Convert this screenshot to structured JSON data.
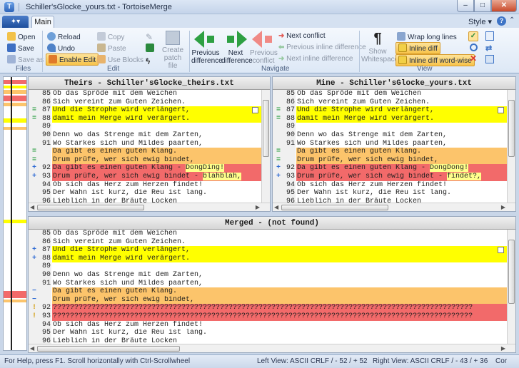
{
  "window": {
    "title": "Schiller'sGlocke_yours.txt - TortoiseMerge",
    "min": "–",
    "max": "□",
    "close": "✕"
  },
  "tabs": {
    "app_menu": "✦▾",
    "main": "Main",
    "style": "Style ▾",
    "help": "?"
  },
  "ribbon": {
    "files": {
      "open": "Open",
      "save": "Save",
      "save_as": "Save as",
      "label": "Files"
    },
    "edit": {
      "reload": "Reload",
      "undo": "Undo",
      "enable_edit": "Enable Edit",
      "copy": "Copy",
      "paste": "Paste",
      "use_blocks": "Use Blocks ▾",
      "create_patch": "Create patch file",
      "label": "Edit"
    },
    "navigate": {
      "prev_diff": "Previous difference",
      "next_diff": "Next difference",
      "prev_conflict": "Previous conflict",
      "next_conflict": "Next conflict",
      "prev_inline": "Previous inline difference",
      "next_inline": "Next inline difference",
      "label": "Navigate"
    },
    "view": {
      "show_ws": "Show Whitespaces",
      "wrap": "Wrap long lines",
      "inline_diff": "Inline diff",
      "inline_word": "Inline diff word-wise",
      "label": "View"
    }
  },
  "theirs": {
    "header": "Theirs - Schiller'sGlocke_theirs.txt",
    "lines": [
      {
        "n": "85",
        "t": "Ob das Spröde mit dem Weichen",
        "bg": "",
        "m": ""
      },
      {
        "n": "86",
        "t": "Sich vereint zum Guten Zeichen.",
        "bg": "",
        "m": ""
      },
      {
        "n": "87",
        "t": "Und die Strophe wird verlängert,",
        "bg": "yellow",
        "m": "="
      },
      {
        "n": "88",
        "t": "damit mein Merge wird verärgert.",
        "bg": "yellow",
        "m": "="
      },
      {
        "n": "89",
        "t": "",
        "bg": "",
        "m": ""
      },
      {
        "n": "90",
        "t": "Denn wo das Strenge mit dem Zarten,",
        "bg": "",
        "m": ""
      },
      {
        "n": "91",
        "t": "Wo Starkes sich und Mildes paarten,",
        "bg": "",
        "m": ""
      },
      {
        "n": "",
        "t": "Da gibt es einen guten Klang.",
        "bg": "orange",
        "m": "="
      },
      {
        "n": "",
        "t": "Drum prüfe, wer sich ewig bindet,",
        "bg": "orange",
        "m": "="
      },
      {
        "n": "92",
        "t": "Da gibt es einen guten Klang - ",
        "w": "DongDing!",
        "bg": "red",
        "m": "+"
      },
      {
        "n": "93",
        "t": "Drum prüfe, wer sich ewig bindet - ",
        "w": "blahblah,",
        "bg": "red",
        "m": "+"
      },
      {
        "n": "94",
        "t": "Ob sich das Herz zum Herzen findet!",
        "bg": "",
        "m": ""
      },
      {
        "n": "95",
        "t": "Der Wahn ist kurz, die Reu ist lang.",
        "bg": "",
        "m": ""
      },
      {
        "n": "96",
        "t": "Lieblich in der Bräute Locken",
        "bg": "",
        "m": ""
      }
    ]
  },
  "mine": {
    "header": "Mine - Schiller'sGlocke_yours.txt",
    "lines": [
      {
        "n": "85",
        "t": "Ob das Spröde mit dem Weichen",
        "bg": "",
        "m": ""
      },
      {
        "n": "86",
        "t": "Sich vereint zum Guten Zeichen.",
        "bg": "",
        "m": ""
      },
      {
        "n": "87",
        "t": "Und die Strophe wird verlängert,",
        "bg": "yellow",
        "m": "="
      },
      {
        "n": "88",
        "t": "damit mein Merge wird verärgert.",
        "bg": "yellow",
        "m": "="
      },
      {
        "n": "89",
        "t": "",
        "bg": "",
        "m": ""
      },
      {
        "n": "90",
        "t": "Denn wo das Strenge mit dem Zarten,",
        "bg": "",
        "m": ""
      },
      {
        "n": "91",
        "t": "Wo Starkes sich und Mildes paarten,",
        "bg": "",
        "m": ""
      },
      {
        "n": "",
        "t": "Da gibt es einen guten Klang.",
        "bg": "orange",
        "m": "="
      },
      {
        "n": "",
        "t": "Drum prüfe, wer sich ewig bindet,",
        "bg": "orange",
        "m": "="
      },
      {
        "n": "92",
        "t": "Da gibt es einen guten Klang - ",
        "w": "DongDong!",
        "bg": "red",
        "m": "+"
      },
      {
        "n": "93",
        "t": "Drum prüfe, wer sich ewig bindet - ",
        "w": "findet?,",
        "bg": "red",
        "m": "+"
      },
      {
        "n": "94",
        "t": "Ob sich das Herz zum Herzen findet!",
        "bg": "",
        "m": ""
      },
      {
        "n": "95",
        "t": "Der Wahn ist kurz, die Reu ist lang.",
        "bg": "",
        "m": ""
      },
      {
        "n": "96",
        "t": "Lieblich in der Bräute Locken",
        "bg": "",
        "m": ""
      }
    ]
  },
  "merged": {
    "header": "Merged -  (not found)",
    "lines": [
      {
        "n": "85",
        "t": "Ob das Spröde mit dem Weichen",
        "bg": "",
        "m": ""
      },
      {
        "n": "86",
        "t": "Sich vereint zum Guten Zeichen.",
        "bg": "",
        "m": ""
      },
      {
        "n": "87",
        "t": "Und die Strophe wird verlängert,",
        "bg": "yellow",
        "m": "+"
      },
      {
        "n": "88",
        "t": "damit mein Merge wird verärgert.",
        "bg": "yellow",
        "m": "+"
      },
      {
        "n": "89",
        "t": "",
        "bg": "",
        "m": ""
      },
      {
        "n": "90",
        "t": "Denn wo das Strenge mit dem Zarten,",
        "bg": "",
        "m": ""
      },
      {
        "n": "91",
        "t": "Wo Starkes sich und Mildes paarten,",
        "bg": "",
        "m": ""
      },
      {
        "n": "",
        "t": "Da gibt es einen guten Klang.",
        "bg": "orange",
        "m": "−"
      },
      {
        "n": "",
        "t": "Drum prüfe, wer sich ewig bindet,",
        "bg": "orange",
        "m": "−"
      },
      {
        "n": "92",
        "t": "??????????????????????????????????????????????????????????????????????????????????????????????????",
        "bg": "red",
        "m": "!"
      },
      {
        "n": "93",
        "t": "??????????????????????????????????????????????????????????????????????????????????????????????????",
        "bg": "red",
        "m": "!"
      },
      {
        "n": "94",
        "t": "Ob sich das Herz zum Herzen findet!",
        "bg": "",
        "m": ""
      },
      {
        "n": "95",
        "t": "Der Wahn ist kurz, die Reu ist lang.",
        "bg": "",
        "m": ""
      },
      {
        "n": "96",
        "t": "Lieblich in der Bräute Locken",
        "bg": "",
        "m": ""
      }
    ]
  },
  "status": {
    "help": "For Help, press F1. Scroll horizontally with Ctrl-Scrollwheel",
    "left_view": "Left View: ASCII CRLF  / - 52 / + 52",
    "right_view": "Right View: ASCII CRLF  / - 43 / + 36",
    "extra": "Cor"
  },
  "colors": {
    "yellow": "#ffff00",
    "orange": "#fcc46b",
    "red": "#f26a6a",
    "accent": "#2ea043"
  }
}
